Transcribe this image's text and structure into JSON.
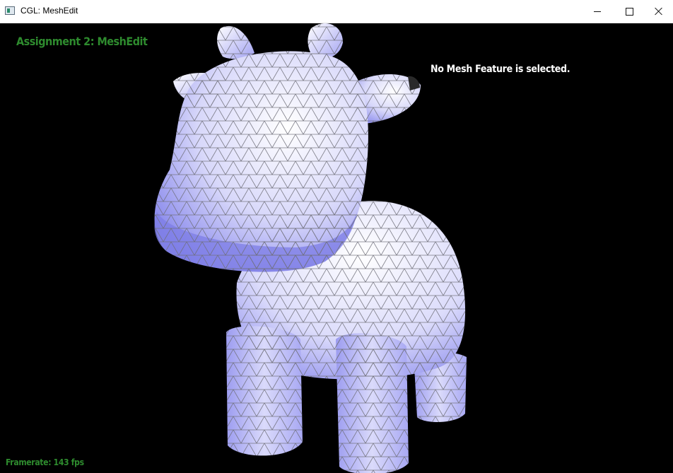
{
  "window": {
    "title": "CGL: MeshEdit",
    "controls": {
      "minimize": "minimize",
      "maximize": "maximize",
      "close": "close"
    }
  },
  "viewport": {
    "assignment_title": "Assignment 2: MeshEdit",
    "selection_status": "No Mesh Feature is selected.",
    "framerate": "Framerate: 143 fps"
  },
  "colors": {
    "overlay_green": "#2e8b2e",
    "status_white": "#ffffff",
    "mesh_light": "#f2f2ff",
    "mesh_shade": "#8c8cf0",
    "wireframe": "#7a7a7a",
    "background": "#000000"
  },
  "icons": [
    "app-icon",
    "minimize-icon",
    "maximize-icon",
    "close-icon"
  ]
}
